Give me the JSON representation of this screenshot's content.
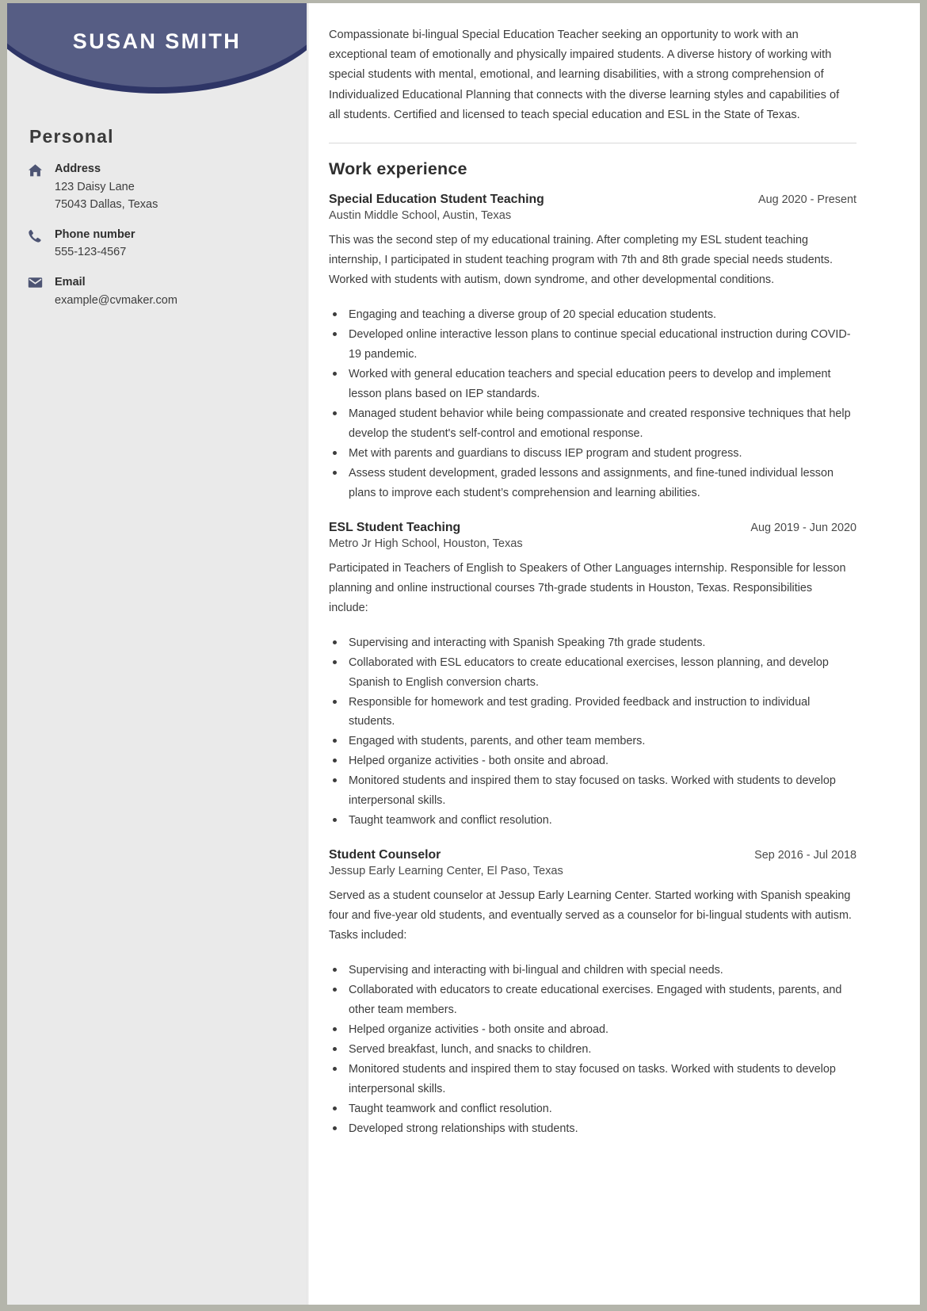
{
  "theme": {
    "header_light": "#565d84",
    "header_dark": "#2e3566",
    "sidebar_bg": "#eaeaea",
    "icon_color": "#4d5473",
    "text_color": "#3c3c3c"
  },
  "sidebar": {
    "name": "SUSAN SMITH",
    "section_title": "Personal",
    "contacts": [
      {
        "icon": "home-icon",
        "label": "Address",
        "line1": "123 Daisy Lane",
        "line2": "75043 Dallas, Texas"
      },
      {
        "icon": "phone-icon",
        "label": "Phone number",
        "line1": "555-123-4567",
        "line2": ""
      },
      {
        "icon": "envelope-icon",
        "label": "Email",
        "line1": "example@cvmaker.com",
        "line2": ""
      }
    ]
  },
  "main": {
    "summary": "Compassionate bi-lingual Special Education Teacher seeking an opportunity to work with an exceptional team of emotionally and physically impaired students. A diverse history of working with special students with mental, emotional, and learning disabilities, with a strong comprehension of Individualized Educational Planning that connects with the diverse learning styles and capabilities of all students. Certified and licensed to teach special education and ESL in the State of Texas.",
    "work_experience_title": "Work experience",
    "jobs": [
      {
        "title": "Special Education Student Teaching",
        "date": "Aug 2020 - Present",
        "organization": "Austin Middle School, Austin, Texas",
        "description": "This was the second step of my educational training. After completing my ESL student teaching internship, I participated in student teaching program with 7th and 8th grade special needs students. Worked with students with autism, down syndrome, and other developmental conditions.",
        "bullets": [
          "Engaging and teaching a diverse group of 20 special education students.",
          "Developed online interactive lesson plans to continue special educational instruction during COVID-19 pandemic.",
          "Worked with general education teachers and special education peers to develop and implement lesson plans based on IEP standards.",
          "Managed student behavior while being compassionate and created responsive techniques that help develop the student's self-control and emotional response.",
          "Met with parents and guardians to discuss IEP program and student progress.",
          "Assess student development, graded lessons and assignments, and fine-tuned individual lesson plans to improve each student’s comprehension and learning abilities."
        ]
      },
      {
        "title": "ESL Student Teaching",
        "date": "Aug 2019 - Jun 2020",
        "organization": "Metro Jr High School, Houston, Texas",
        "description": "Participated in Teachers of English to Speakers of Other Languages internship. Responsible for lesson planning and online instructional courses 7th-grade students in Houston, Texas. Responsibilities include:",
        "bullets": [
          "Supervising and interacting with Spanish Speaking 7th grade students.",
          "Collaborated with ESL educators to create educational exercises, lesson planning, and develop Spanish to English conversion charts.",
          "Responsible for homework and test grading. Provided feedback and instruction to individual students.",
          "Engaged with students, parents, and other team members.",
          "Helped organize activities - both onsite and abroad.",
          "Monitored students and inspired them to stay focused on tasks. Worked with students to develop interpersonal skills.",
          "Taught teamwork and conflict resolution."
        ]
      },
      {
        "title": "Student Counselor",
        "date": "Sep 2016 - Jul 2018",
        "organization": "Jessup Early Learning Center, El Paso, Texas",
        "description": "Served as a student counselor at Jessup Early Learning Center. Started working with Spanish speaking four and five-year old students, and eventually served as a counselor for bi-lingual students with autism. Tasks included:",
        "bullets": [
          "Supervising and interacting with bi-lingual and children with special needs.",
          "Collaborated with educators to create educational exercises. Engaged with students, parents, and other team members.",
          "Helped organize activities - both onsite and abroad.",
          "Served breakfast, lunch, and snacks to children.",
          "Monitored students and inspired them to stay focused on tasks. Worked with students to develop interpersonal skills.",
          "Taught teamwork and conflict resolution.",
          "Developed strong relationships with students."
        ]
      }
    ]
  }
}
